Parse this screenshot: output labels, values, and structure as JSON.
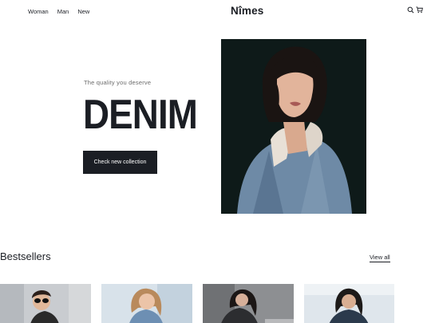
{
  "header": {
    "nav": [
      "Woman",
      "Man",
      "New"
    ],
    "logo": "Nîmes",
    "icons": [
      "search-icon",
      "cart-icon"
    ]
  },
  "hero": {
    "tagline": "The quality you deserve",
    "title": "DENIM",
    "cta_label": "Check new collection"
  },
  "bestsellers": {
    "title": "Bestsellers",
    "view_all_label": "View all",
    "products": 4
  },
  "colors": {
    "text": "#1b1e24",
    "button_bg": "#1b1e24",
    "background": "#ffffff"
  }
}
